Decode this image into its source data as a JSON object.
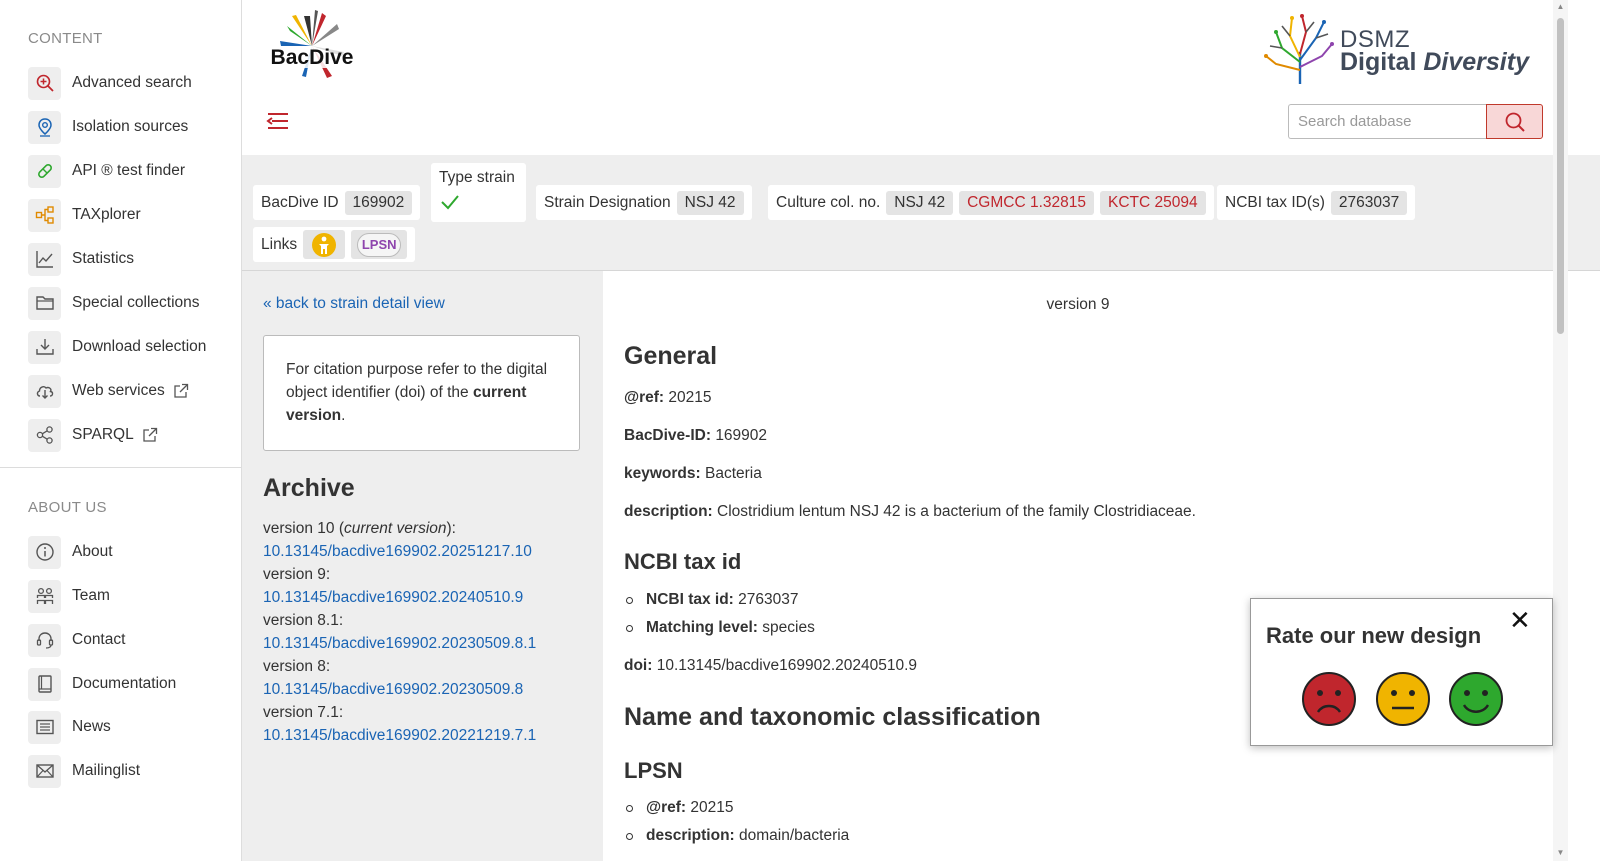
{
  "sidebar": {
    "content_title": "CONTENT",
    "content_items": [
      {
        "label": "Advanced search",
        "icon": "zoom-plus-icon"
      },
      {
        "label": "Isolation sources",
        "icon": "map-pin-icon"
      },
      {
        "label": "API ® test finder",
        "icon": "pill-icon"
      },
      {
        "label": "TAXplorer",
        "icon": "tree-diagram-icon"
      },
      {
        "label": "Statistics",
        "icon": "line-chart-icon"
      },
      {
        "label": "Special collections",
        "icon": "folder-icon"
      },
      {
        "label": "Download selection",
        "icon": "download-tray-icon"
      },
      {
        "label": "Web services",
        "icon": "cloud-download-icon"
      },
      {
        "label": "SPARQL",
        "icon": "share-nodes-icon"
      }
    ],
    "about_title": "ABOUT US",
    "about_items": [
      {
        "label": "About",
        "icon": "info-icon"
      },
      {
        "label": "Team",
        "icon": "team-icon"
      },
      {
        "label": "Contact",
        "icon": "headset-icon"
      },
      {
        "label": "Documentation",
        "icon": "book-icon"
      },
      {
        "label": "News",
        "icon": "newspaper-icon"
      },
      {
        "label": "Mailinglist",
        "icon": "envelope-icon"
      }
    ]
  },
  "header": {
    "logo_text": "BacDive",
    "dsmz_line1": "DSMZ",
    "dsmz_line2a": "Digital",
    "dsmz_line2b": "Diversity",
    "search_placeholder": "Search database"
  },
  "strain": {
    "bacdive_id_label": "BacDive ID",
    "bacdive_id": "169902",
    "type_strain_label": "Type strain",
    "designation_label": "Strain Designation",
    "designation": "NSJ 42",
    "culture_label": "Culture col. no.",
    "culture_numbers": [
      "NSJ 42",
      "CGMCC 1.32815",
      "KCTC 25094"
    ],
    "ncbi_label": "NCBI tax ID(s)",
    "ncbi_id": "2763037",
    "links_label": "Links",
    "lpsn_label": "LPSN"
  },
  "left_panel": {
    "back_link": "« back to strain detail view",
    "cite_text": "For citation purpose refer to the digital object identifier (doi) of the",
    "cite_bold": "current version",
    "cite_end": ".",
    "archive_title": "Archive",
    "archive": [
      {
        "version": "version 10 (",
        "note": "current version",
        "suffix": "):",
        "doi": "10.13145/bacdive169902.20251217.10"
      },
      {
        "version": "version 9:",
        "note": "",
        "suffix": "",
        "doi": "10.13145/bacdive169902.20240510.9"
      },
      {
        "version": "version 8.1:",
        "note": "",
        "suffix": "",
        "doi": "10.13145/bacdive169902.20230509.8.1"
      },
      {
        "version": "version 8:",
        "note": "",
        "suffix": "",
        "doi": "10.13145/bacdive169902.20230509.8"
      },
      {
        "version": "version 7.1:",
        "note": "",
        "suffix": "",
        "doi": "10.13145/bacdive169902.20221219.7.1"
      }
    ]
  },
  "main": {
    "version_label": "version 9",
    "general_title": "General",
    "ref_label": "@ref:",
    "ref_value": "20215",
    "bacdive_label": "BacDive-ID:",
    "bacdive_value": "169902",
    "keywords_label": "keywords:",
    "keywords_value": "Bacteria",
    "description_label": "description:",
    "description_value": "Clostridium lentum NSJ 42 is a bacterium of the family Clostridiaceae.",
    "ncbi_title": "NCBI tax id",
    "ncbi_taxid_label": "NCBI tax id:",
    "ncbi_taxid_value": "2763037",
    "matching_label": "Matching level:",
    "matching_value": "species",
    "doi_label": "doi:",
    "doi_value": "10.13145/bacdive169902.20240510.9",
    "taxonomy_title": "Name and taxonomic classification",
    "lpsn_title": "LPSN",
    "lpsn_ref_label": "@ref:",
    "lpsn_ref_value": "20215",
    "lpsn_desc_label": "description:",
    "lpsn_desc_value": "domain/bacteria"
  },
  "rating": {
    "title": "Rate our new design",
    "close_glyph": "✕",
    "faces": [
      "sad-face-icon",
      "neutral-face-icon",
      "happy-face-icon"
    ],
    "colors": [
      "#c0262d",
      "#f0b400",
      "#2ea82e"
    ]
  }
}
